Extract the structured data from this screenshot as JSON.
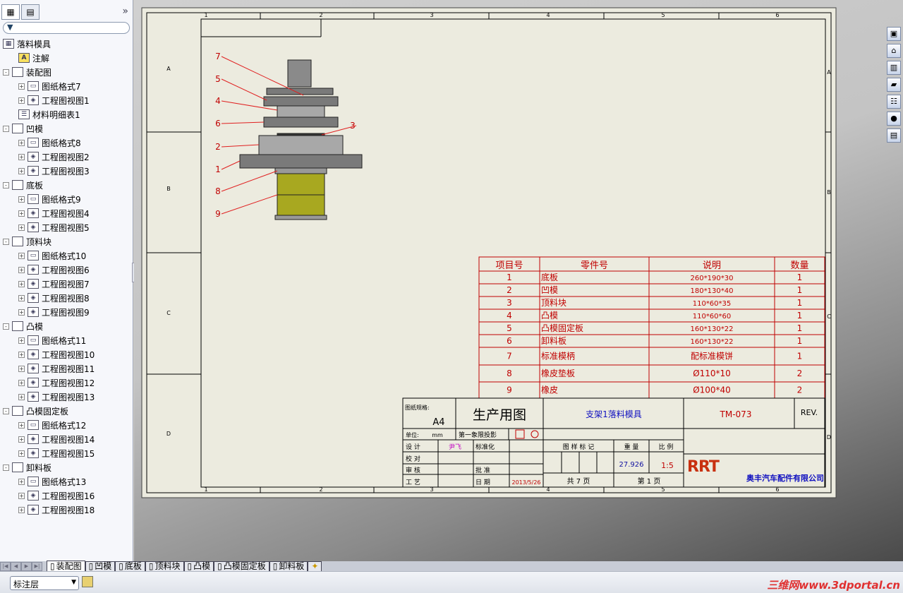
{
  "sidebar": {
    "tabs": [
      "feature-manager",
      "property-manager"
    ],
    "expand": "»",
    "filter_icon": "funnel-icon",
    "items": [
      {
        "label": "落料模具",
        "level": 0,
        "icon": "drawing",
        "exp": ""
      },
      {
        "label": "注解",
        "level": 1,
        "icon": "A",
        "exp": ""
      },
      {
        "label": "装配图",
        "level": 0,
        "icon": "sheet",
        "exp": "-"
      },
      {
        "label": "图纸格式7",
        "level": 1,
        "icon": "format",
        "exp": "+"
      },
      {
        "label": "工程图视图1",
        "level": 1,
        "icon": "view",
        "exp": "+"
      },
      {
        "label": "材料明细表1",
        "level": 1,
        "icon": "bom",
        "exp": ""
      },
      {
        "label": "凹模",
        "level": 0,
        "icon": "sheet",
        "exp": "-"
      },
      {
        "label": "图纸格式8",
        "level": 1,
        "icon": "format",
        "exp": "+"
      },
      {
        "label": "工程图视图2",
        "level": 1,
        "icon": "view",
        "exp": "+"
      },
      {
        "label": "工程图视图3",
        "level": 1,
        "icon": "view",
        "exp": "+"
      },
      {
        "label": "底板",
        "level": 0,
        "icon": "sheet",
        "exp": "-"
      },
      {
        "label": "图纸格式9",
        "level": 1,
        "icon": "format",
        "exp": "+"
      },
      {
        "label": "工程图视图4",
        "level": 1,
        "icon": "view",
        "exp": "+"
      },
      {
        "label": "工程图视图5",
        "level": 1,
        "icon": "view",
        "exp": "+"
      },
      {
        "label": "顶料块",
        "level": 0,
        "icon": "sheet",
        "exp": "-"
      },
      {
        "label": "图纸格式10",
        "level": 1,
        "icon": "format",
        "exp": "+"
      },
      {
        "label": "工程图视图6",
        "level": 1,
        "icon": "view",
        "exp": "+"
      },
      {
        "label": "工程图视图7",
        "level": 1,
        "icon": "view",
        "exp": "+"
      },
      {
        "label": "工程图视图8",
        "level": 1,
        "icon": "view",
        "exp": "+"
      },
      {
        "label": "工程图视图9",
        "level": 1,
        "icon": "view",
        "exp": "+"
      },
      {
        "label": "凸模",
        "level": 0,
        "icon": "sheet",
        "exp": "-"
      },
      {
        "label": "图纸格式11",
        "level": 1,
        "icon": "format",
        "exp": "+"
      },
      {
        "label": "工程图视图10",
        "level": 1,
        "icon": "view",
        "exp": "+"
      },
      {
        "label": "工程图视图11",
        "level": 1,
        "icon": "view",
        "exp": "+"
      },
      {
        "label": "工程图视图12",
        "level": 1,
        "icon": "view",
        "exp": "+"
      },
      {
        "label": "工程图视图13",
        "level": 1,
        "icon": "view",
        "exp": "+"
      },
      {
        "label": "凸模固定板",
        "level": 0,
        "icon": "sheet",
        "exp": "-"
      },
      {
        "label": "图纸格式12",
        "level": 1,
        "icon": "format",
        "exp": "+"
      },
      {
        "label": "工程图视图14",
        "level": 1,
        "icon": "view",
        "exp": "+"
      },
      {
        "label": "工程图视图15",
        "level": 1,
        "icon": "view",
        "exp": "+"
      },
      {
        "label": "卸料板",
        "level": 0,
        "icon": "sheet",
        "exp": "-"
      },
      {
        "label": "图纸格式13",
        "level": 1,
        "icon": "format",
        "exp": "+"
      },
      {
        "label": "工程图视图16",
        "level": 1,
        "icon": "view",
        "exp": "+"
      },
      {
        "label": "工程图视图18",
        "level": 1,
        "icon": "view",
        "exp": "+"
      }
    ]
  },
  "sheet": {
    "zones_cols": [
      "1",
      "2",
      "3",
      "4",
      "5",
      "6"
    ],
    "zones_rows": [
      "A",
      "B",
      "C",
      "D"
    ],
    "balloons": [
      "7",
      "5",
      "4",
      "6",
      "3",
      "2",
      "1",
      "8",
      "9"
    ],
    "bom": {
      "headers": [
        "项目号",
        "零件号",
        "说明",
        "数量"
      ],
      "rows": [
        [
          "1",
          "底板",
          "260*190*30",
          "1"
        ],
        [
          "2",
          "凹模",
          "180*130*40",
          "1"
        ],
        [
          "3",
          "顶料块",
          "110*60*35",
          "1"
        ],
        [
          "4",
          "凸模",
          "110*60*60",
          "1"
        ],
        [
          "5",
          "凸模固定板",
          "160*130*22",
          "1"
        ],
        [
          "6",
          "卸料板",
          "160*130*22",
          "1"
        ],
        [
          "7",
          "标准模柄",
          "配标准模饼",
          "1"
        ],
        [
          "8",
          "橡皮垫板",
          "Ø110*10",
          "2"
        ],
        [
          "9",
          "橡皮",
          "Ø100*40",
          "2"
        ]
      ]
    },
    "title_block": {
      "paper_size_label": "图纸规格:",
      "paper_size": "A4",
      "stage": "生产用图",
      "drawing_name": "支架1落料模具",
      "drawing_number": "TM-073",
      "rev_label": "REV.",
      "unit_label": "单位:",
      "unit": "mm",
      "projection": "第一象限投影",
      "design_label": "设  计",
      "designer": "尹飞",
      "check_label": "校  对",
      "review_label": "审  核",
      "process_label": "工  艺",
      "std_label": "标准化",
      "approve_label": "批  准",
      "date_label": "日  期",
      "date": "2013/5/26",
      "mark_label": "图 样 标 记",
      "weight_label": "重  量",
      "scale_label": "比  例",
      "weight": "27.926",
      "scale": "1:5",
      "total_sheets": "共  7  页",
      "sheet_no": "第  1  页",
      "company": "奥丰汽车配件有限公司",
      "logo": "RRT"
    }
  },
  "right_toolbar": [
    "view-palette-icon",
    "home-icon",
    "library-icon",
    "folder-icon",
    "properties-icon",
    "appearance-icon",
    "custom-props-icon"
  ],
  "sheet_tabs": [
    "装配图",
    "凹模",
    "底板",
    "顶料块",
    "凸模",
    "凸模固定板",
    "卸料板"
  ],
  "status": {
    "layer": "标注层",
    "watermark": "三维网www.3dportal.cn"
  },
  "colors": {
    "bom_red": "#c00000",
    "sheet_bg": "#ecebdf",
    "rubber": "#a8a820"
  }
}
